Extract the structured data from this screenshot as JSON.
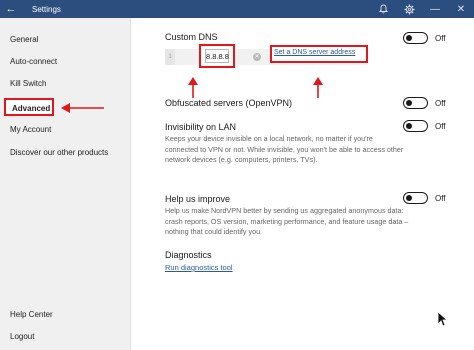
{
  "window": {
    "title": "Settings"
  },
  "sidebar": {
    "items": [
      {
        "label": "General"
      },
      {
        "label": "Auto-connect"
      },
      {
        "label": "Kill Switch"
      },
      {
        "label": "Advanced",
        "active": true
      },
      {
        "label": "My Account"
      },
      {
        "label": "Discover our other products"
      }
    ],
    "bottom": [
      {
        "label": "Help Center"
      },
      {
        "label": "Logout"
      }
    ]
  },
  "custom_dns": {
    "label": "Custom DNS",
    "toggle": "Off",
    "index": "1",
    "server_value": "8.8.8.8",
    "add_link": "Set a DNS server address"
  },
  "obfuscated": {
    "label": "Obfuscated servers (OpenVPN)",
    "toggle": "Off"
  },
  "invisibility": {
    "label": "Invisibility on LAN",
    "toggle": "Off",
    "desc_line1": "Keeps your device invisible on a local network, no matter if you're",
    "desc_line2": "connected to VPN or not. While invisible, you won't be able to access other",
    "desc_line3": "network devices (e.g. computers, printers, TVs)."
  },
  "help_improve": {
    "label": "Help us improve",
    "toggle": "Off",
    "desc_line1": "Help us make NordVPN better by sending us aggregated anonymous data:",
    "desc_line2": "crash reports, OS version, marketing performance, and feature usage data –",
    "desc_line3": "nothing that could identify you."
  },
  "diagnostics": {
    "label": "Diagnostics",
    "link": "Run diagnostics tool"
  },
  "icons": {
    "back": "back-arrow-icon",
    "notification": "bell-icon",
    "settings": "gear-icon",
    "minimize": "minimize-icon",
    "close": "close-icon"
  },
  "colors": {
    "titlebar": "#2b4e7e",
    "highlight": "#e0181c",
    "link": "#2a5b9c"
  }
}
